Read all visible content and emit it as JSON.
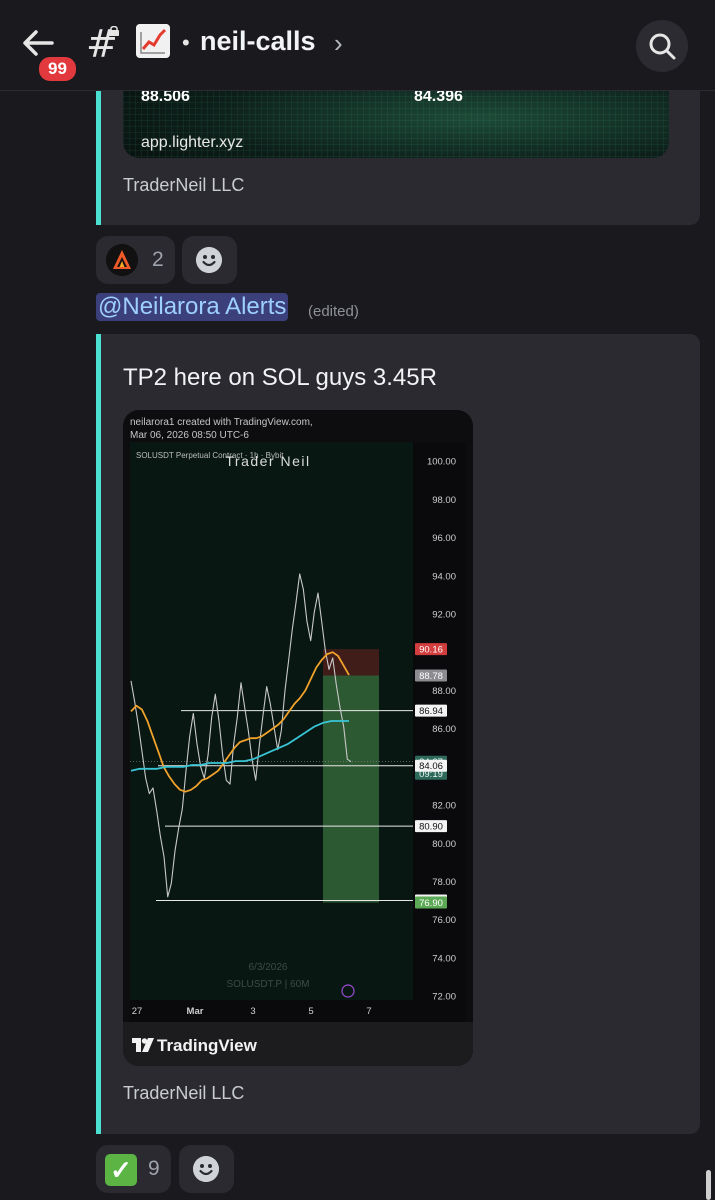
{
  "header": {
    "back_icon": "back-arrow-icon",
    "unread_badge": "99",
    "channel_emoji": "chart-increasing-emoji",
    "channel_name": "neil-calls",
    "separator": "•",
    "chevron": "›"
  },
  "embed1": {
    "value_left": "88.506",
    "value_right": "84.396",
    "site": "app.lighter.xyz",
    "footer": "TraderNeil LLC"
  },
  "reactions1": [
    {
      "emoji": "fire-logo-emoji",
      "count": "2"
    }
  ],
  "message2": {
    "mention": "@Neilarora Alerts",
    "edited": "(edited)",
    "text": "TP2 here on SOL guys 3.45R",
    "footer": "TraderNeil LLC"
  },
  "tradingview": {
    "created_line1": "neilarora1 created with TradingView.com,",
    "created_line2": "Mar 06, 2026 08:50 UTC-6",
    "brand": "TradingView"
  },
  "chart_data": {
    "type": "line",
    "title": "SOLUSDT Perpetual Contract · 1h · Bybit",
    "watermark": "Trader Neil",
    "bottom_watermark_date": "6/3/2026",
    "bottom_watermark_symbol": "SOLUSDT.P | 60M",
    "y_ticks": [
      "100.00",
      "98.00",
      "96.00",
      "94.00",
      "92.00",
      "88.00",
      "86.00",
      "82.00",
      "80.00",
      "78.00",
      "76.00",
      "74.00",
      "72.00"
    ],
    "x_ticks": [
      "27",
      "Mar",
      "3",
      "5",
      "7"
    ],
    "ylim": [
      72,
      100
    ],
    "price_labels": [
      {
        "value": "90.16",
        "kind": "stop"
      },
      {
        "value": "88.78",
        "kind": "entry"
      },
      {
        "value": "86.94",
        "kind": "level"
      },
      {
        "value": "84.27",
        "kind": "current"
      },
      {
        "value": "09:19",
        "kind": "countdown"
      },
      {
        "value": "84.06",
        "kind": "level"
      },
      {
        "value": "80.90",
        "kind": "level"
      },
      {
        "value": "77.01",
        "kind": "level"
      },
      {
        "value": "76.90",
        "kind": "target"
      }
    ],
    "horizontal_levels": [
      86.94,
      84.06,
      80.9,
      77.01
    ],
    "position": {
      "stop": 90.16,
      "entry": 88.78,
      "target": 76.9
    },
    "series": [
      {
        "kind": "price",
        "color": "#c8c8c8",
        "values": [
          88.5,
          87.4,
          86.2,
          84.8,
          83.4,
          82.6,
          82.9,
          81.7,
          80.4,
          79.3,
          77.2,
          77.9,
          79.6,
          80.8,
          81.8,
          83.8,
          85.6,
          86.8,
          85.2,
          84.0,
          83.4,
          84.6,
          86.6,
          87.8,
          86.4,
          84.6,
          83.3,
          83.1,
          85.2,
          86.6,
          88.4,
          87.1,
          85.9,
          84.4,
          83.3,
          85.1,
          86.7,
          88.2,
          87.3,
          86.1,
          84.9,
          85.9,
          88.0,
          89.6,
          91.2,
          92.6,
          94.1,
          93.3,
          91.6,
          90.6,
          92.1,
          93.1,
          91.6,
          90.1,
          89.1,
          89.7,
          88.3,
          87.1,
          86.1,
          84.4,
          84.27
        ]
      },
      {
        "kind": "ema_fast",
        "color": "#f0a22b",
        "values": [
          86.9,
          87.2,
          87.0,
          86.4,
          85.6,
          84.8,
          84.0,
          83.5,
          83.1,
          82.8,
          82.7,
          82.8,
          83.0,
          83.3,
          83.4,
          83.6,
          83.8,
          84.2,
          84.6,
          85.0,
          85.3,
          85.4,
          85.5,
          85.5,
          85.6,
          85.8,
          86.0,
          86.2,
          86.5,
          86.9,
          87.3,
          87.6,
          88.0,
          88.6,
          89.2,
          89.6,
          89.9,
          90.0,
          89.8,
          89.3,
          88.8
        ]
      },
      {
        "kind": "ema_slow",
        "color": "#38c6d6",
        "values": [
          83.8,
          83.9,
          83.9,
          83.9,
          84.0,
          84.0,
          84.0,
          84.1,
          84.1,
          84.2,
          84.2,
          84.2,
          84.3,
          84.3,
          84.4,
          84.6,
          84.8,
          85.0,
          85.2,
          85.5,
          85.8,
          86.1,
          86.3,
          86.4,
          86.4,
          86.4
        ]
      }
    ]
  }
}
